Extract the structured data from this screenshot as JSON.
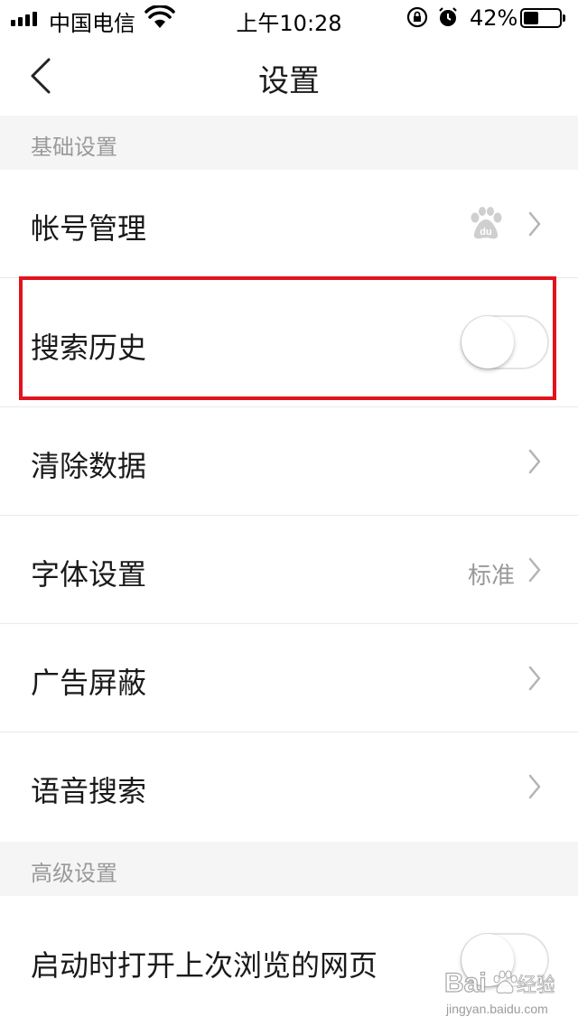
{
  "status_bar": {
    "carrier": "中国电信",
    "time": "上午10:28",
    "battery_percent": "42%",
    "battery_level": 0.42
  },
  "nav": {
    "title": "设置",
    "back_icon": "chevron-left-icon"
  },
  "sections": {
    "basic": {
      "title": "基础设置"
    },
    "advanced": {
      "title": "高级设置"
    }
  },
  "rows": {
    "account": {
      "label": "帐号管理",
      "icon": "baidu-paw-logo"
    },
    "search_history": {
      "label": "搜索历史",
      "toggle_on": false
    },
    "clear_data": {
      "label": "清除数据"
    },
    "font": {
      "label": "字体设置",
      "value": "标准"
    },
    "ad_block": {
      "label": "广告屏蔽"
    },
    "voice_search": {
      "label": "语音搜索"
    },
    "restore_last": {
      "label": "启动时打开上次浏览的网页",
      "toggle_on": false
    }
  },
  "watermark": {
    "brand": "Bai",
    "brand_suffix": "经验",
    "url": "jingyan.baidu.com"
  },
  "colors": {
    "highlight": "#e0141e",
    "section_bg": "#f5f5f5",
    "secondary_text": "#999999"
  }
}
